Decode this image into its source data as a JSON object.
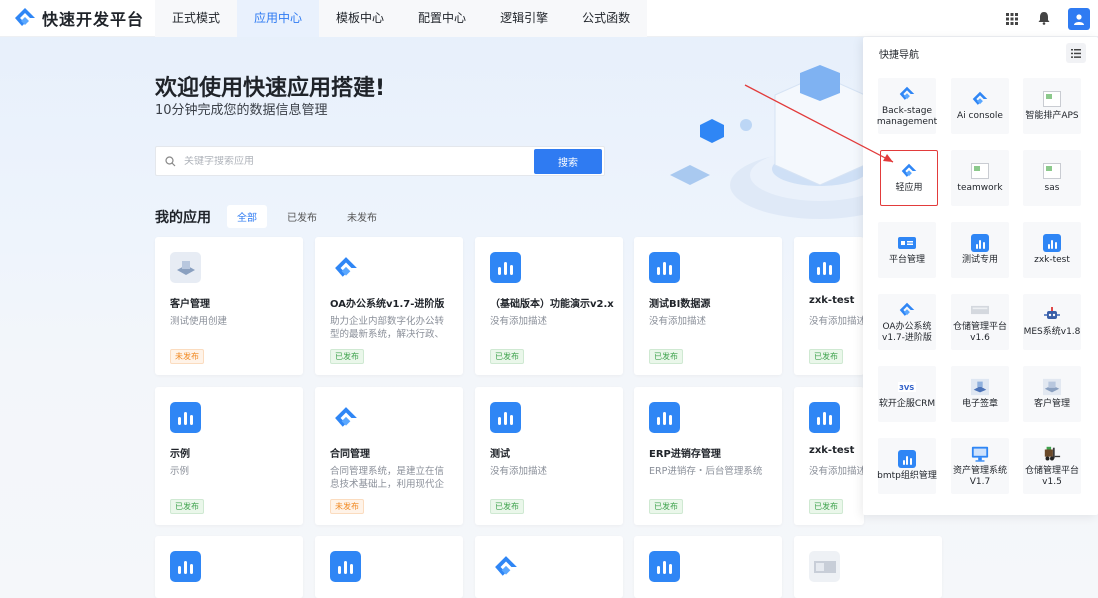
{
  "brand": {
    "name": "快速开发平台"
  },
  "nav": [
    {
      "label": "正式模式",
      "active": false
    },
    {
      "label": "应用中心",
      "active": true
    },
    {
      "label": "模板中心",
      "active": false
    },
    {
      "label": "配置中心",
      "active": false
    },
    {
      "label": "逻辑引擎",
      "active": false
    },
    {
      "label": "公式函数",
      "active": false
    }
  ],
  "top_icons": [
    "grid-icon",
    "bell-icon",
    "user-icon"
  ],
  "hero": {
    "title": "欢迎使用快速应用搭建!",
    "subtitle": "10分钟完成您的数据信息管理"
  },
  "search": {
    "placeholder": "关键字搜索应用",
    "button": "搜索"
  },
  "apps": {
    "title": "我的应用",
    "filters": [
      {
        "label": "全部",
        "active": true
      },
      {
        "label": "已发布",
        "active": false
      },
      {
        "label": "未发布",
        "active": false
      }
    ],
    "cards": [
      {
        "name": "客户管理",
        "desc": "测试使用创建",
        "status": "未发布",
        "icon": "server-image-icon"
      },
      {
        "name": "OA办公系统v1.7-进阶版",
        "desc": "助力企业内部数字化办公转型的最新系统，解决行政、财…",
        "status": "已发布",
        "icon": "logo-icon"
      },
      {
        "name": "（基础版本）功能演示v2.x",
        "desc": "没有添加描述",
        "status": "已发布",
        "icon": "chart-bar-icon"
      },
      {
        "name": "测试BI数据源",
        "desc": "没有添加描述",
        "status": "已发布",
        "icon": "chart-bar-icon"
      },
      {
        "name": "zxk-test",
        "desc": "没有添加描述",
        "status": "已发布",
        "icon": "chart-bar-icon"
      },
      {
        "name": "示例",
        "desc": "示例",
        "status": "已发布",
        "icon": "chart-bar-icon"
      },
      {
        "name": "合同管理",
        "desc": "合同管理系统，是建立在信息技术基础上，利用现代企业…",
        "status": "未发布",
        "icon": "logo-icon"
      },
      {
        "name": "测试",
        "desc": "没有添加描述",
        "status": "已发布",
        "icon": "chart-bar-icon"
      },
      {
        "name": "ERP进销存管理",
        "desc": "ERP进销存・后台管理系统",
        "status": "已发布",
        "icon": "chart-bar-icon"
      },
      {
        "name": "zxk-test",
        "desc": "没有添加描述",
        "status": "已发布",
        "icon": "chart-bar-icon"
      },
      {
        "name": "",
        "desc": "",
        "status": "",
        "icon": "chart-bar-icon"
      },
      {
        "name": "",
        "desc": "",
        "status": "",
        "icon": "chart-bar-icon"
      },
      {
        "name": "",
        "desc": "",
        "status": "",
        "icon": "logo-icon"
      },
      {
        "name": "",
        "desc": "",
        "status": "",
        "icon": "chart-bar-icon"
      },
      {
        "name": "",
        "desc": "",
        "status": "",
        "icon": "device-image-icon"
      }
    ]
  },
  "quick_nav": {
    "title": "快捷导航",
    "items": [
      {
        "label": "Back-stage management",
        "icon": "logo-icon"
      },
      {
        "label": "Ai console",
        "icon": "logo-icon"
      },
      {
        "label": "智能排产APS",
        "icon": "broken-image-icon"
      },
      {
        "label": "轻应用",
        "icon": "logo-icon",
        "highlighted": true
      },
      {
        "label": "teamwork",
        "icon": "broken-image-icon"
      },
      {
        "label": "sas",
        "icon": "broken-image-icon"
      },
      {
        "label": "平台管理",
        "icon": "platform-icon"
      },
      {
        "label": "测试专用",
        "icon": "chart-bar-icon"
      },
      {
        "label": "zxk-test",
        "icon": "chart-bar-icon"
      },
      {
        "label": "OA办公系统v1.7-进阶版",
        "icon": "logo-icon"
      },
      {
        "label": "仓储管理平台v1.6",
        "icon": "warehouse-image-icon"
      },
      {
        "label": "MES系统v1.8",
        "icon": "robot-icon"
      },
      {
        "label": "软开企服CRM",
        "icon": "crm-logo-icon"
      },
      {
        "label": "电子签章",
        "icon": "seal-image-icon"
      },
      {
        "label": "客户管理",
        "icon": "server-image-icon"
      },
      {
        "label": "bmtp组织管理",
        "icon": "chart-bar-icon"
      },
      {
        "label": "资产管理系统V1.7",
        "icon": "monitor-icon"
      },
      {
        "label": "仓储管理平台v1.5",
        "icon": "forklift-icon"
      }
    ]
  },
  "colors": {
    "primary": "#2f7bf2",
    "published": "#3fa34d",
    "unpublished": "#f08a24",
    "highlight_border": "#e23b3b"
  }
}
